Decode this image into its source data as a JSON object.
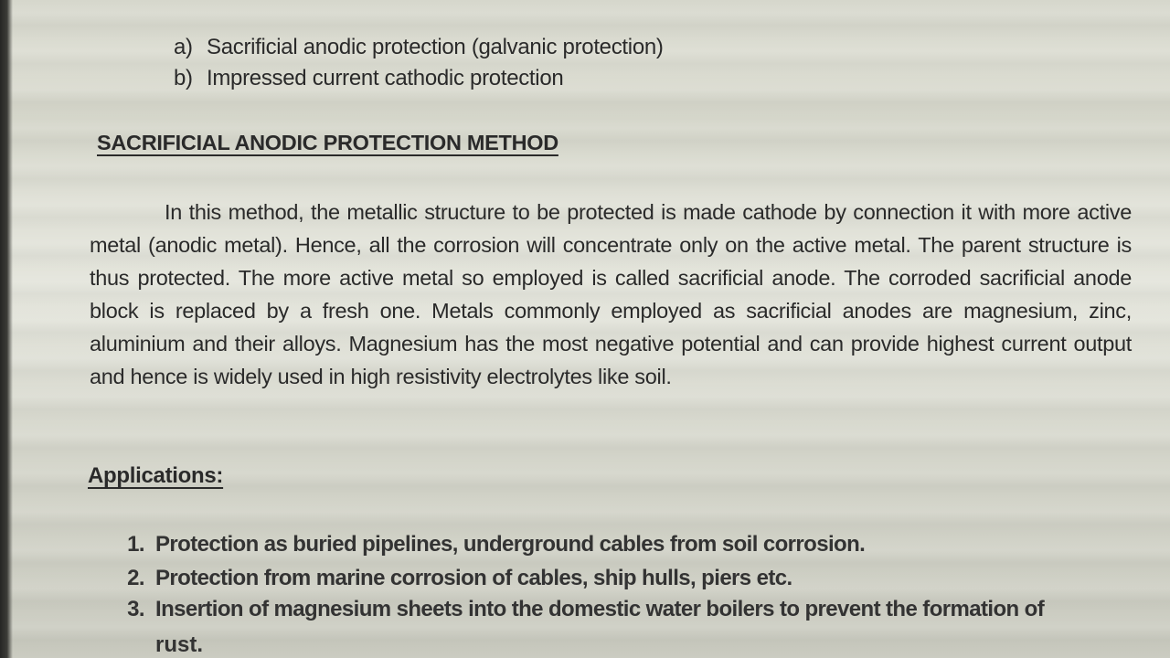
{
  "method_list": [
    {
      "marker": "a)",
      "text": "Sacrificial anodic protection (galvanic protection)"
    },
    {
      "marker": "b)",
      "text": "Impressed current cathodic protection"
    }
  ],
  "section": {
    "heading": "SACRIFICIAL ANODIC PROTECTION METHOD",
    "paragraph": "In this method, the metallic structure to be protected is made cathode by connection it with more active metal (anodic metal). Hence, all the corrosion will concentrate only on the active metal. The parent structure is thus protected. The more active metal so employed is called sacrificial anode. The corroded sacrificial anode block is replaced by a fresh one. Metals commonly employed as sacrificial anodes are magnesium, zinc, aluminium and their alloys. Magnesium has the most negative potential and can provide highest current output and hence is widely used in high resistivity electrolytes like soil."
  },
  "applications": {
    "heading": "Applications:",
    "items": [
      {
        "number": "1.",
        "text": "Protection as buried pipelines, underground cables from soil corrosion."
      },
      {
        "number": "2.",
        "text": "Protection from marine corrosion of cables, ship hulls, piers etc."
      },
      {
        "number": "3.",
        "text": "Insertion of magnesium sheets into the domestic water boilers to prevent the formation of",
        "continuation": "rust."
      }
    ]
  }
}
